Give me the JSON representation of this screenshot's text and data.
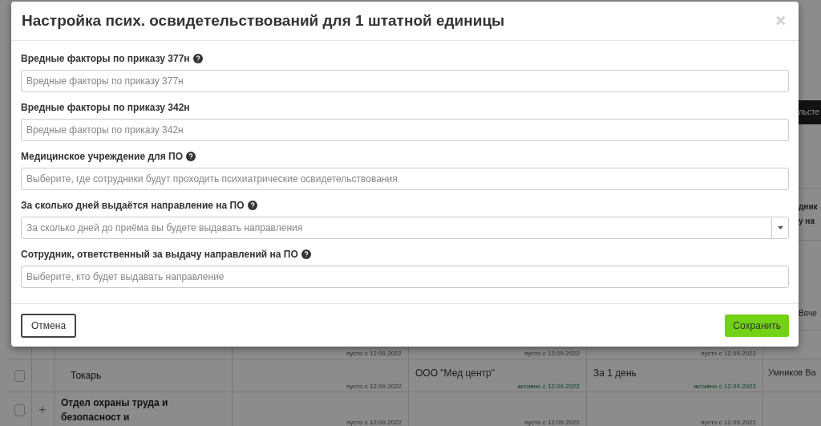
{
  "modal": {
    "title": "Настройка псих. освидетельствований для 1 штатной единицы",
    "close": "×",
    "fields": [
      {
        "kind": "text",
        "label": "Вредные факторы по приказу 377н",
        "help": true,
        "placeholder": "Вредные факторы по приказу 377н"
      },
      {
        "kind": "text",
        "label": "Вредные факторы по приказу 342н",
        "help": false,
        "placeholder": "Вредные факторы по приказу 342н"
      },
      {
        "kind": "text",
        "label": "Медицинское учреждение для ПО",
        "help": true,
        "placeholder": "Выберите, где сотрудники будут проходить психиатрические освидетельствования"
      },
      {
        "kind": "select",
        "label": "За сколько дней выдаётся направление на ПО",
        "help": true,
        "placeholder": "За сколько дней до приёма вы будете выдавать направления"
      },
      {
        "kind": "text",
        "label": "Сотрудник, ответственный за выдачу направлений на ПО",
        "help": true,
        "placeholder": "Выберите, кто будет выдавать направление"
      }
    ],
    "cancel": "Отмена",
    "save": "Сохранить"
  },
  "background": {
    "header_fragment": "льсте",
    "row_fragments": [
      [
        "дник",
        "у на"
      ],
      [
        "Вяче"
      ]
    ],
    "rows": [
      {
        "cells": [
          {
            "text": "",
            "status": "пусто с 12.09.2022",
            "active": false
          },
          {
            "text": "",
            "status": "пусто с 12.09.2022",
            "active": false
          },
          {
            "text": "",
            "status": "пусто с 12.09.2022",
            "active": false
          }
        ],
        "last": ""
      },
      {
        "kind": "item",
        "checked": false,
        "name": "Токарь",
        "cells": [
          {
            "text": "",
            "status": "пусто с 12.09.2022",
            "active": false
          },
          {
            "text": "ООО \"Мед центр\"",
            "status": "активно с 12.09.2022",
            "active": true
          },
          {
            "text": "За 1 день",
            "status": "активно с 12.09.2022",
            "active": true
          }
        ],
        "last": "Умников Ва"
      },
      {
        "kind": "group",
        "checked": false,
        "expand": "+",
        "name": "Отдел охраны труда и безопасност и",
        "cells": [
          {
            "text": "",
            "status": "пусто с 12.09.2022",
            "active": false
          },
          {
            "text": "",
            "status": "пусто с 12.09.2022",
            "active": false
          },
          {
            "text": "",
            "status": "пусто с 12.09.2022",
            "active": false
          }
        ],
        "last": ""
      }
    ]
  }
}
